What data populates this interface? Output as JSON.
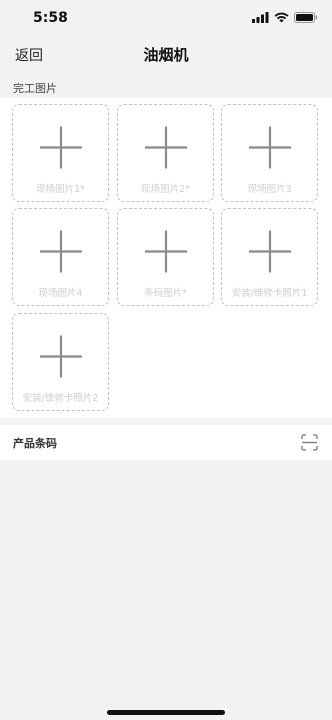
{
  "status_bar": {
    "time": "5:58"
  },
  "nav": {
    "back_label": "返回",
    "title": "油烟机"
  },
  "photos_section": {
    "label": "完工图片",
    "tiles": [
      {
        "label": "现场图片1*"
      },
      {
        "label": "现场图片2*"
      },
      {
        "label": "现场图片3"
      },
      {
        "label": "现场图片4"
      },
      {
        "label": "条码图片*"
      },
      {
        "label": "安装/维修卡照片1"
      },
      {
        "label": "安装/维修卡照片2"
      }
    ]
  },
  "barcode_section": {
    "label": "产品条码",
    "icon": "scan-icon"
  },
  "colors": {
    "background": "#f2f2f2",
    "panel": "#ffffff",
    "dashed_border": "#c2c2c2",
    "plus": "#8a8a8a",
    "tile_label": "#cfcfcf"
  }
}
